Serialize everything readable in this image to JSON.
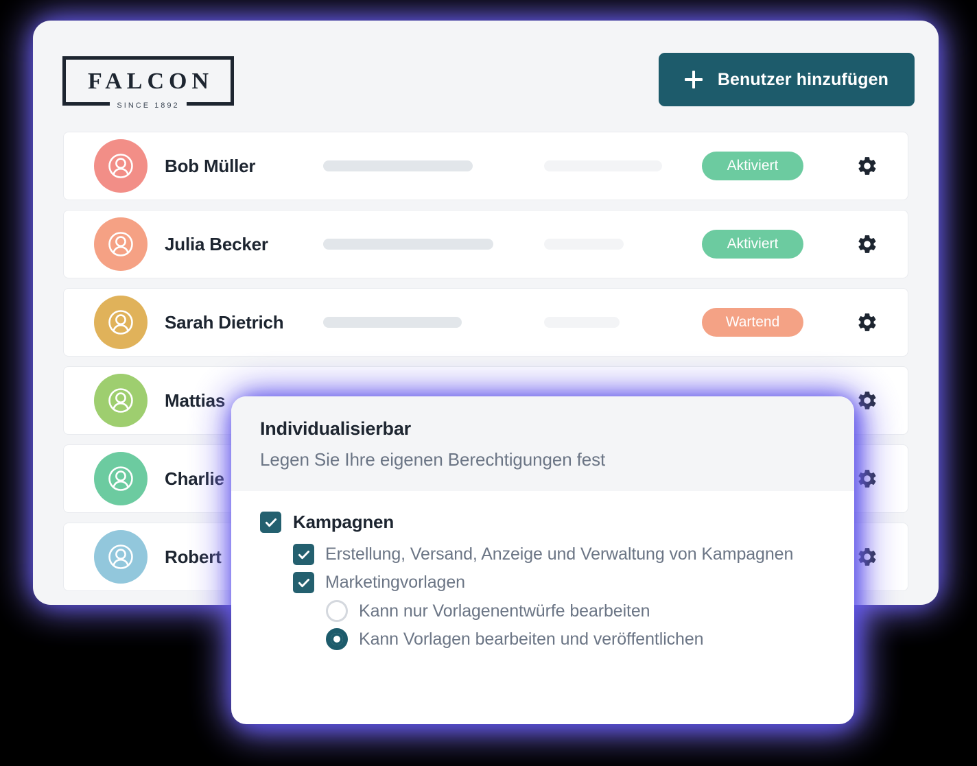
{
  "brand": {
    "logo_word": "FALCON",
    "logo_tagline": "SINCE 1892"
  },
  "header": {
    "add_user_label": "Benutzer hinzufügen",
    "add_user_icon": "plus-icon",
    "accent_color": "#1d5b6b"
  },
  "colors": {
    "page_bg": "#f4f5f7",
    "glow": "#6c5ce7",
    "teal": "#1d5b6b",
    "checkbox_teal": "#24606f",
    "status_active": "#6ccba0",
    "status_pending": "#f4a285",
    "text_dark": "#1d2530",
    "text_muted": "#6b7585",
    "skeleton_dark": "#e2e6ea",
    "skeleton_light": "#f3f4f6"
  },
  "users": [
    {
      "name": "Bob Müller",
      "avatar_color": "#f28e87",
      "avatar_icon": "account-circle-icon",
      "status": "Aktiviert",
      "status_color": "#6ccba0",
      "bar_a_width": 218,
      "bar_b_width": 172,
      "settings_icon": "gear-icon"
    },
    {
      "name": "Julia Becker",
      "avatar_color": "#f5a184",
      "avatar_icon": "account-circle-icon",
      "status": "Aktiviert",
      "status_color": "#6ccba0",
      "bar_a_width": 248,
      "bar_b_width": 116,
      "settings_icon": "gear-icon"
    },
    {
      "name": "Sarah Dietrich",
      "avatar_color": "#e0b25a",
      "avatar_icon": "account-circle-icon",
      "status": "Wartend",
      "status_color": "#f4a285",
      "bar_a_width": 202,
      "bar_b_width": 110,
      "settings_icon": "gear-icon"
    },
    {
      "name": "Mattias",
      "avatar_color": "#9ece6f",
      "avatar_icon": "account-circle-icon",
      "status": "",
      "status_color": "",
      "bar_a_width": 0,
      "bar_b_width": 0,
      "settings_icon": "gear-icon"
    },
    {
      "name": "Charlie",
      "avatar_color": "#6ccba0",
      "avatar_icon": "account-circle-icon",
      "status": "",
      "status_color": "",
      "bar_a_width": 0,
      "bar_b_width": 0,
      "settings_icon": "gear-icon"
    },
    {
      "name": "Robert",
      "avatar_color": "#92c7dc",
      "avatar_icon": "account-circle-icon",
      "status": "",
      "status_color": "",
      "bar_a_width": 0,
      "bar_b_width": 0,
      "settings_icon": "gear-icon"
    }
  ],
  "modal": {
    "title": "Individualisierbar",
    "subtitle": "Legen Sie Ihre eigenen Berechtigungen fest",
    "options": [
      {
        "kind": "checkbox",
        "checked": true,
        "level": 0,
        "label": "Kampagnen",
        "strong": true
      },
      {
        "kind": "checkbox",
        "checked": true,
        "level": 1,
        "label": "Erstellung, Versand, Anzeige und Verwaltung von Kampagnen",
        "strong": false
      },
      {
        "kind": "checkbox",
        "checked": true,
        "level": 1,
        "label": "Marketingvorlagen",
        "strong": false
      },
      {
        "kind": "radio",
        "checked": false,
        "level": 2,
        "label": "Kann nur Vorlagenentwürfe bearbeiten",
        "strong": false
      },
      {
        "kind": "radio",
        "checked": true,
        "level": 2,
        "label": "Kann Vorlagen bearbeiten und veröffentlichen",
        "strong": false
      }
    ]
  }
}
